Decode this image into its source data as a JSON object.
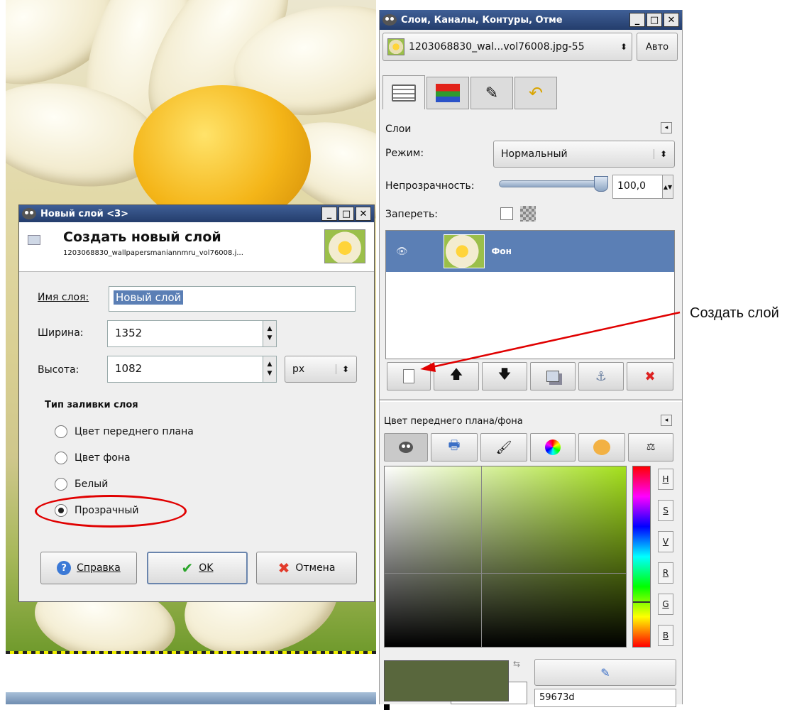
{
  "canvas_view": {
    "image": "daisy-wallpaper"
  },
  "new_layer_dialog": {
    "title": "Новый слой <3>",
    "header_title": "Создать новый слой",
    "header_subtitle": "1203068830_wallpapersmaniannmru_vol76008.j...",
    "name_label": "Имя слоя:",
    "name_value": "Новый слой",
    "width_label": "Ширина:",
    "width_value": "1352",
    "height_label": "Высота:",
    "height_value": "1082",
    "unit": "px",
    "fill_type_label": "Тип заливки слоя",
    "fill_options": [
      "Цвет переднего плана",
      "Цвет фона",
      "Белый",
      "Прозрачный"
    ],
    "fill_selected": "Прозрачный",
    "help_button": "Справка",
    "ok_button": "OK",
    "cancel_button": "Отмена"
  },
  "dock": {
    "title": "Слои, Каналы, Контуры, Отме",
    "image_selector": "1203068830_wal...vol76008.jpg-55",
    "auto_button": "Авто",
    "tab_icons": [
      "layers-icon",
      "channels-icon",
      "paths-icon",
      "undo-history-icon"
    ],
    "layers_title": "Слои",
    "mode_label": "Режим:",
    "mode_value": "Нормальный",
    "opacity_label": "Непрозрачность:",
    "opacity_value": "100,0",
    "opacity_fraction": 1.0,
    "lock_label": "Запереть:",
    "layers": [
      {
        "name": "Фон",
        "visible": true,
        "selected": true
      }
    ],
    "layer_buttons": [
      "new-layer-button",
      "raise-layer-button",
      "lower-layer-button",
      "duplicate-layer-button",
      "anchor-layer-button",
      "delete-layer-button"
    ],
    "colors_title": "Цвет переднего плана/фона",
    "color_tab_icons": [
      "gimp-icon",
      "printer-icon",
      "brush-icon",
      "color-wheel-icon",
      "palette-icon",
      "scales-icon"
    ],
    "channels": [
      "H",
      "S",
      "V",
      "R",
      "G",
      "B"
    ],
    "hex_value": "59673d",
    "fg_color": "#59673d"
  },
  "annotation": {
    "label": "Создать слой",
    "color": "#e00000"
  }
}
